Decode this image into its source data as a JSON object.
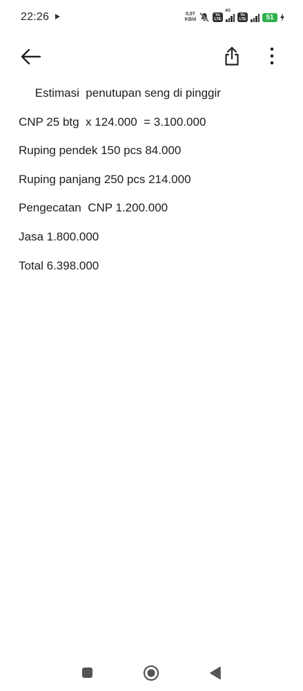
{
  "status_bar": {
    "time": "22:26",
    "net_speed_value": "0,07",
    "net_speed_unit": "KB/d",
    "volte_label_top": "Vo",
    "volte_label_bottom": "LTE",
    "network_type": "4G",
    "battery_level": "51"
  },
  "toolbar": {
    "back_icon": "arrow-left-icon",
    "share_icon": "share-icon",
    "more_icon": "more-vert-icon"
  },
  "note": {
    "lines": [
      "     Estimasi  penutupan seng di pinggir",
      "CNP 25 btg  x 124.000  = 3.100.000",
      "Ruping pendek 150 pcs 84.000",
      "Ruping panjang 250 pcs 214.000",
      "Pengecatan  CNP 1.200.000",
      "Jasa 1.800.000",
      "Total 6.398.000"
    ]
  },
  "nav_bar": {
    "recent_icon": "recent-apps-icon",
    "home_icon": "home-icon",
    "back_icon": "nav-back-icon"
  },
  "colors": {
    "battery": "#2fb14c",
    "text": "#1c1c1c",
    "background": "#ffffff"
  }
}
